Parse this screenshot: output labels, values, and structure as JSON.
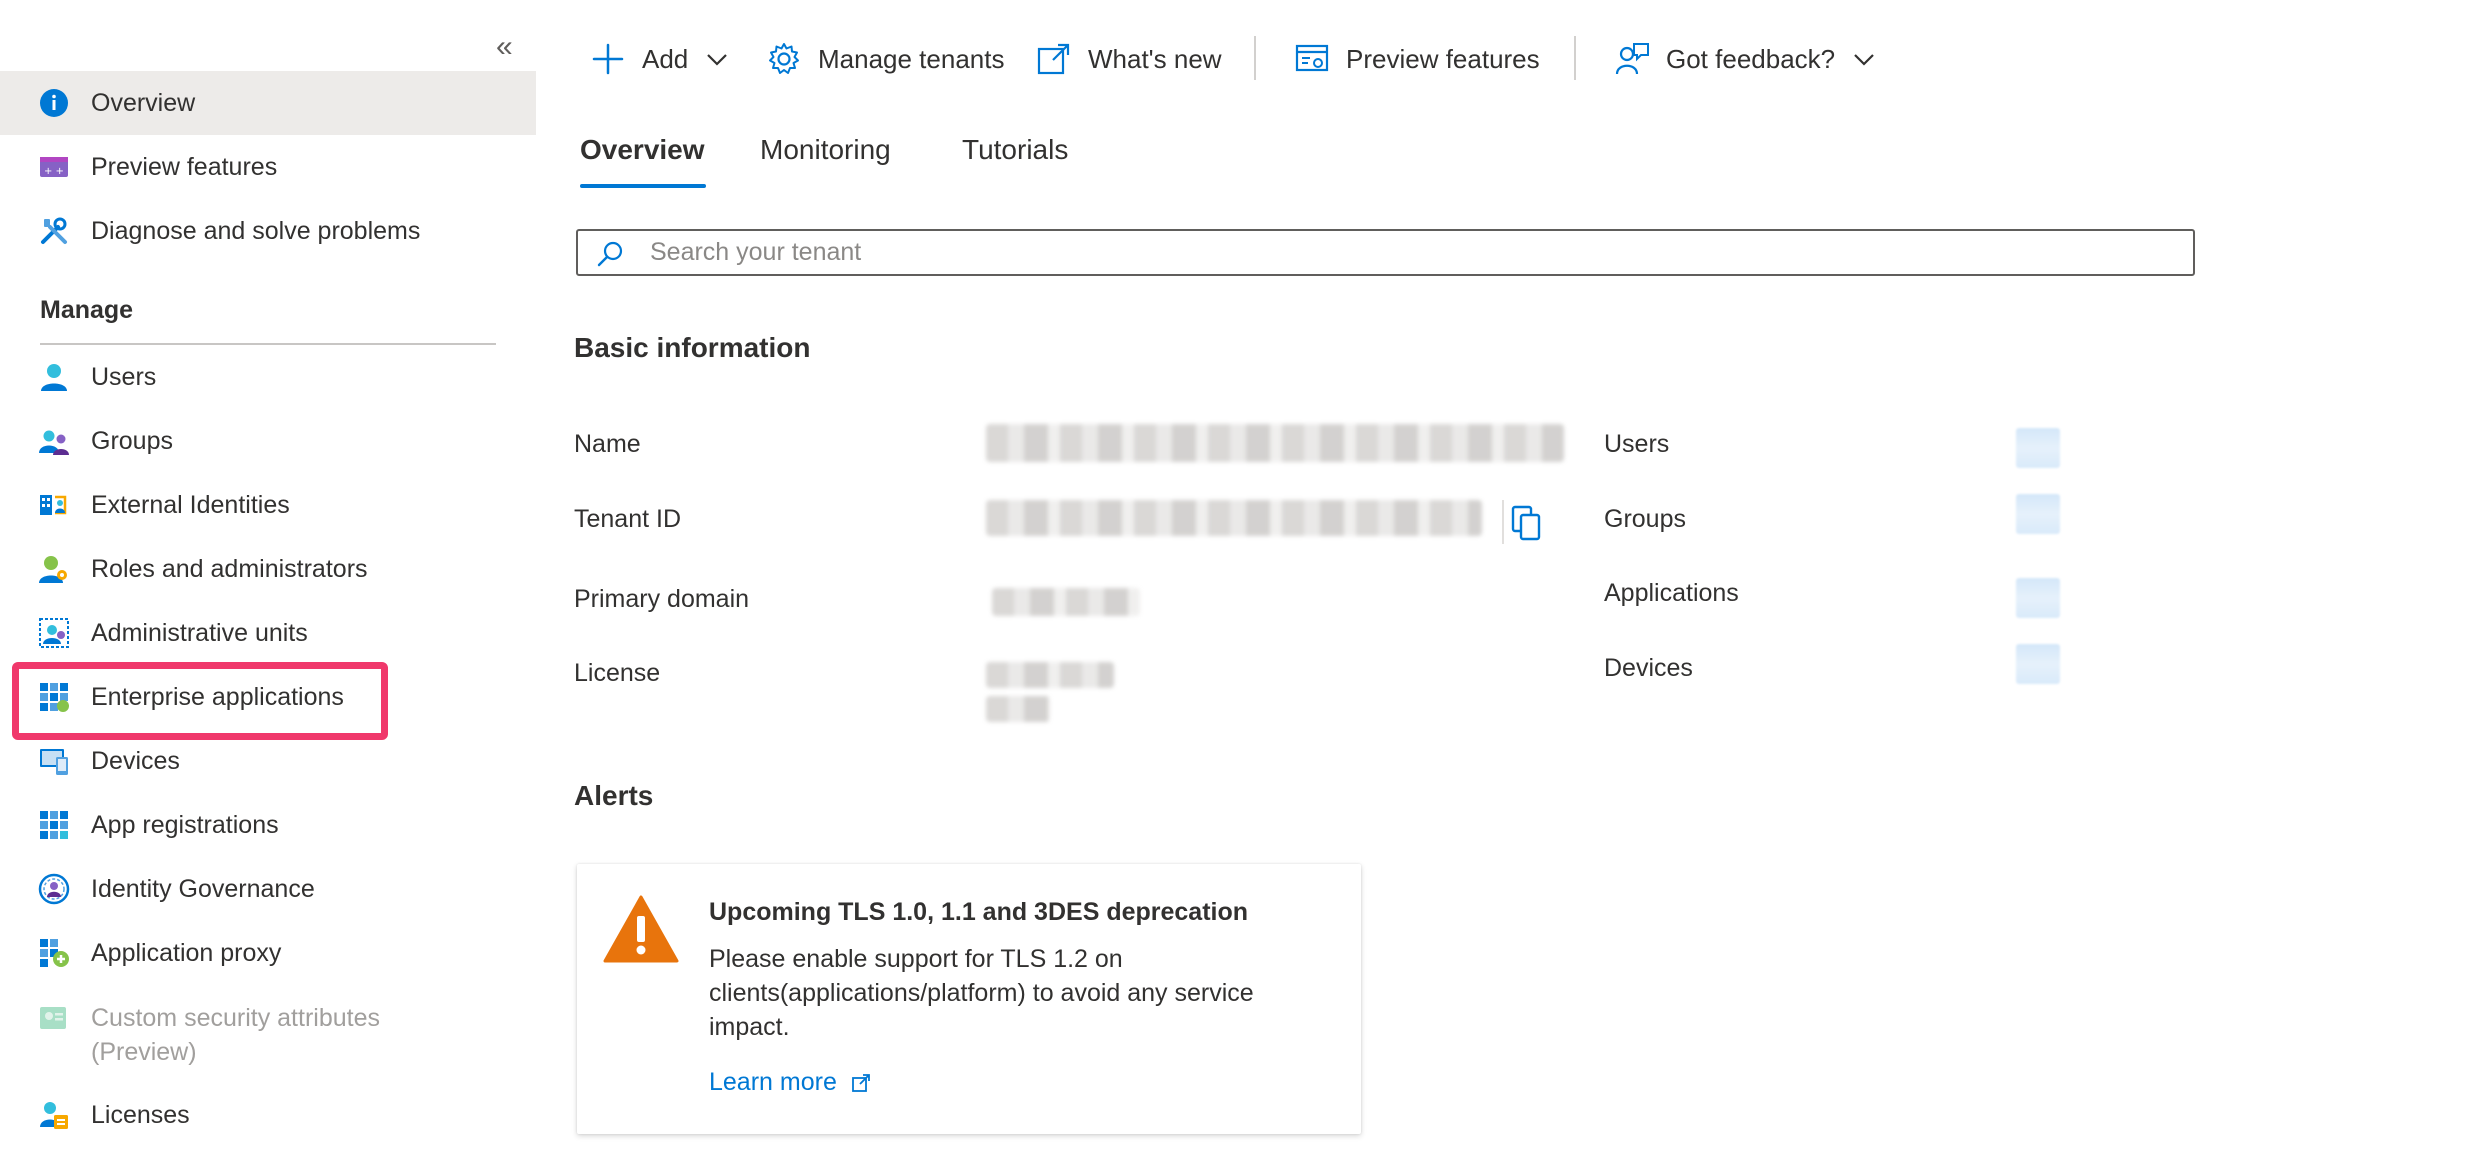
{
  "sidebar": {
    "collapse_glyph": "«",
    "items_top": [
      {
        "label": "Overview",
        "icon": "info-icon",
        "selected": true
      },
      {
        "label": "Preview features",
        "icon": "preview-features-icon"
      },
      {
        "label": "Diagnose and solve problems",
        "icon": "tools-icon"
      }
    ],
    "manage_header": "Manage",
    "items_manage": [
      {
        "label": "Users",
        "icon": "user-icon"
      },
      {
        "label": "Groups",
        "icon": "groups-icon"
      },
      {
        "label": "External Identities",
        "icon": "external-identities-icon"
      },
      {
        "label": "Roles and administrators",
        "icon": "roles-icon"
      },
      {
        "label": "Administrative units",
        "icon": "admin-units-icon"
      },
      {
        "label": "Enterprise applications",
        "icon": "enterprise-apps-icon",
        "highlighted": true
      },
      {
        "label": "Devices",
        "icon": "devices-icon"
      },
      {
        "label": "App registrations",
        "icon": "app-registrations-icon"
      },
      {
        "label": "Identity Governance",
        "icon": "identity-governance-icon"
      },
      {
        "label": "Application proxy",
        "icon": "application-proxy-icon"
      },
      {
        "label": "Custom security attributes\n(Preview)",
        "icon": "custom-security-icon",
        "disabled": true
      },
      {
        "label": "Licenses",
        "icon": "licenses-icon"
      }
    ]
  },
  "toolbar": {
    "add": "Add",
    "manage_tenants": "Manage tenants",
    "whats_new": "What's new",
    "preview_features": "Preview features",
    "got_feedback": "Got feedback?"
  },
  "tabs": [
    {
      "label": "Overview",
      "active": true
    },
    {
      "label": "Monitoring"
    },
    {
      "label": "Tutorials"
    }
  ],
  "search": {
    "placeholder": "Search your tenant",
    "value": ""
  },
  "basic_info": {
    "heading": "Basic information",
    "labels": {
      "name": "Name",
      "tenant_id": "Tenant ID",
      "primary_domain": "Primary domain",
      "license": "License"
    },
    "counts": {
      "users": "Users",
      "groups": "Groups",
      "applications": "Applications",
      "devices": "Devices"
    }
  },
  "alerts": {
    "heading": "Alerts",
    "card": {
      "title": "Upcoming TLS 1.0, 1.1 and 3DES deprecation",
      "body": "Please enable support for TLS 1.2 on clients(applications/platform) to avoid any service impact.",
      "link": "Learn more"
    }
  },
  "colors": {
    "accent": "#0078d4",
    "highlight": "#f0386b",
    "warning": "#e8740c",
    "selected_bg": "#edebe9"
  }
}
